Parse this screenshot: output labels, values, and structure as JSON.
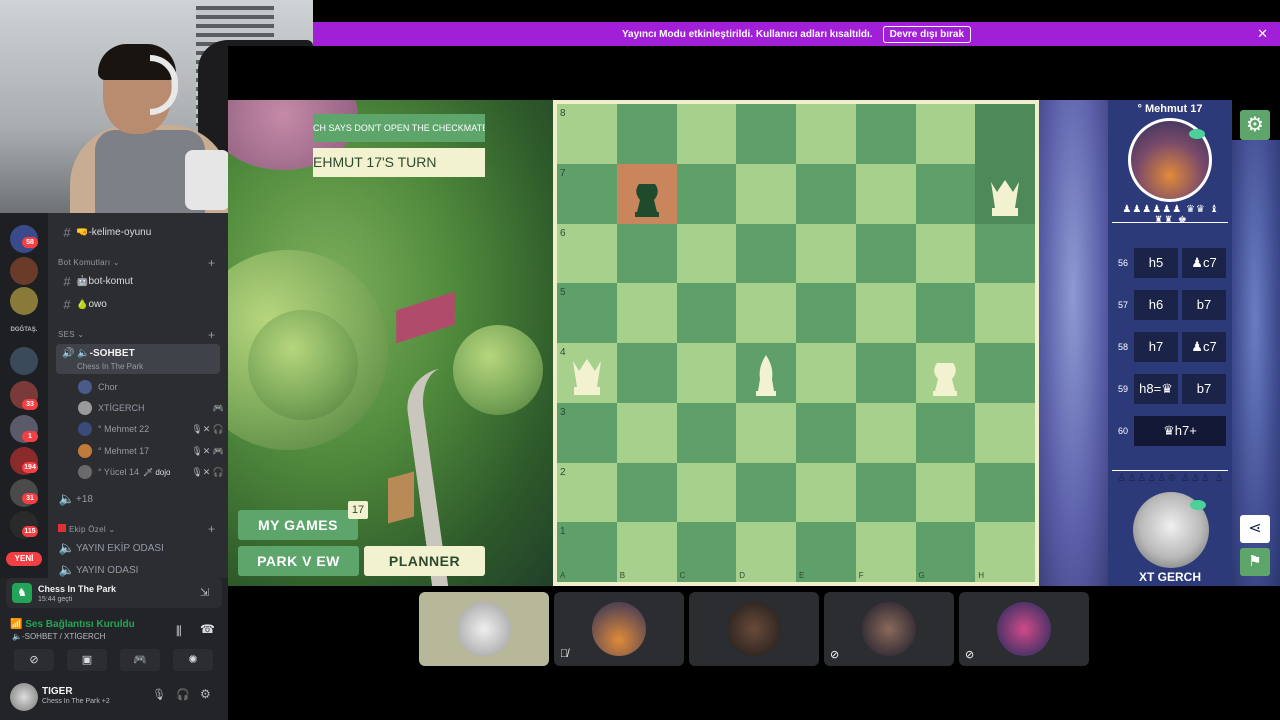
{
  "banner": {
    "text": "Yayıncı Modu etkinleştirildi. Kullanıcı adları kısaltıldı.",
    "button": "Devre dışı bırak",
    "close": "✕"
  },
  "servers": {
    "badges": [
      "58",
      "33",
      "1",
      "194",
      "31",
      "115"
    ],
    "label": "DGĞTAŞ.",
    "yeni": "YENİ"
  },
  "channels": {
    "text1": "🤜-kelime-oyunu",
    "cat_bot": "Bot Komutları ⌄",
    "bot_komut": "🤖bot-komut",
    "owo": "🍐owo",
    "cat_ses": "SES ⌄",
    "voice_name": "🔈-SOHBET",
    "voice_activity": "Chess In The Park",
    "users": [
      {
        "name": "Chor",
        "icons": ""
      },
      {
        "name": "XTİGERCH",
        "icons": "🎮"
      },
      {
        "name": "° Mehmet 22",
        "icons": "🎙✕ 🎧"
      },
      {
        "name": "° Mehmet 17",
        "icons": "🎙✕ 🎮"
      },
      {
        "name": "° Yücel 14",
        "tag": "🗡 dojo",
        "icons": "🎙✕ 🎧"
      }
    ],
    "more": "+18",
    "cat_ekip": "Ekip Özel ⌄",
    "ekip1": "YAYIN EKİP ODASI",
    "ekip2": "YAYIN ODASI"
  },
  "activity": {
    "title": "Chess In The Park",
    "time": "15:44 geçti"
  },
  "connection": {
    "status": "Ses Bağlantısı Kuruldu",
    "channel": "🔈-SOHBET / XTİGERCH"
  },
  "me": {
    "name": "TIGER",
    "status": "Chess In The Park +2"
  },
  "game": {
    "banner1": "CH SAYS DON'T OPEN THE CHECKMATE",
    "banner2": "EHMUT 17'S TURN",
    "my_games": "MY GAMES",
    "games_count": "17",
    "park_view": "PARK V EW",
    "planner": "PLANNER",
    "opponent": "° Mehmut 17",
    "opp_captures": "♟♟♟♟♟♟ ♛♛ ♝ ♜♜ ♚",
    "my_captures": "♙♙♙♙♙♔ ♙♙♙ ♙",
    "player": "XT GERCH",
    "ranks": [
      "8",
      "7",
      "6",
      "5",
      "4",
      "3",
      "2",
      "1"
    ],
    "files": [
      "A",
      "B",
      "C",
      "D",
      "E",
      "F",
      "G",
      "H"
    ]
  },
  "moves": [
    {
      "n": "56",
      "w": "h5",
      "b": "♟c7"
    },
    {
      "n": "57",
      "w": "h6",
      "b": "b7"
    },
    {
      "n": "58",
      "w": "h7",
      "b": "♟c7"
    },
    {
      "n": "59",
      "w": "h8=♛",
      "b": "b7"
    },
    {
      "n": "60",
      "full": "♛h7+"
    }
  ],
  "colors": {
    "light": "#a8d08d",
    "dark": "#5e9f6a",
    "accent": "#5ea56c",
    "banner": "#a11fd6"
  }
}
